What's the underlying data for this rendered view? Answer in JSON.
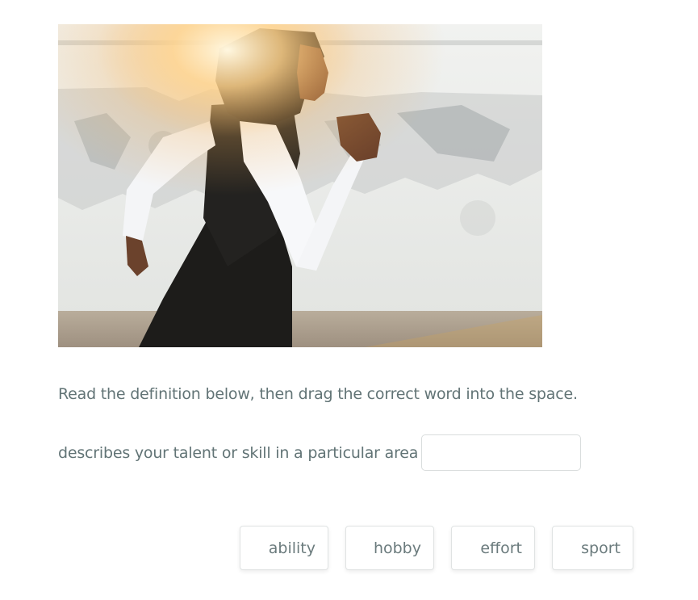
{
  "exercise": {
    "instruction": "Read the definition below, then drag the correct word into the space.",
    "definition": "describes your talent or skill in a particular area",
    "answer_slot_value": ""
  },
  "word_bank": {
    "words": [
      "ability",
      "hobby",
      "effort",
      "sport"
    ]
  },
  "photo": {
    "subject": "woman in black hijab and white long sleeves running past a weathered white wall",
    "colors": {
      "wall": "#e9ebe8",
      "sleeve": "#f7f8fa",
      "vest": "#1b1a18",
      "sunlight": "#f6b04a",
      "ground": "#b5aa98"
    }
  }
}
